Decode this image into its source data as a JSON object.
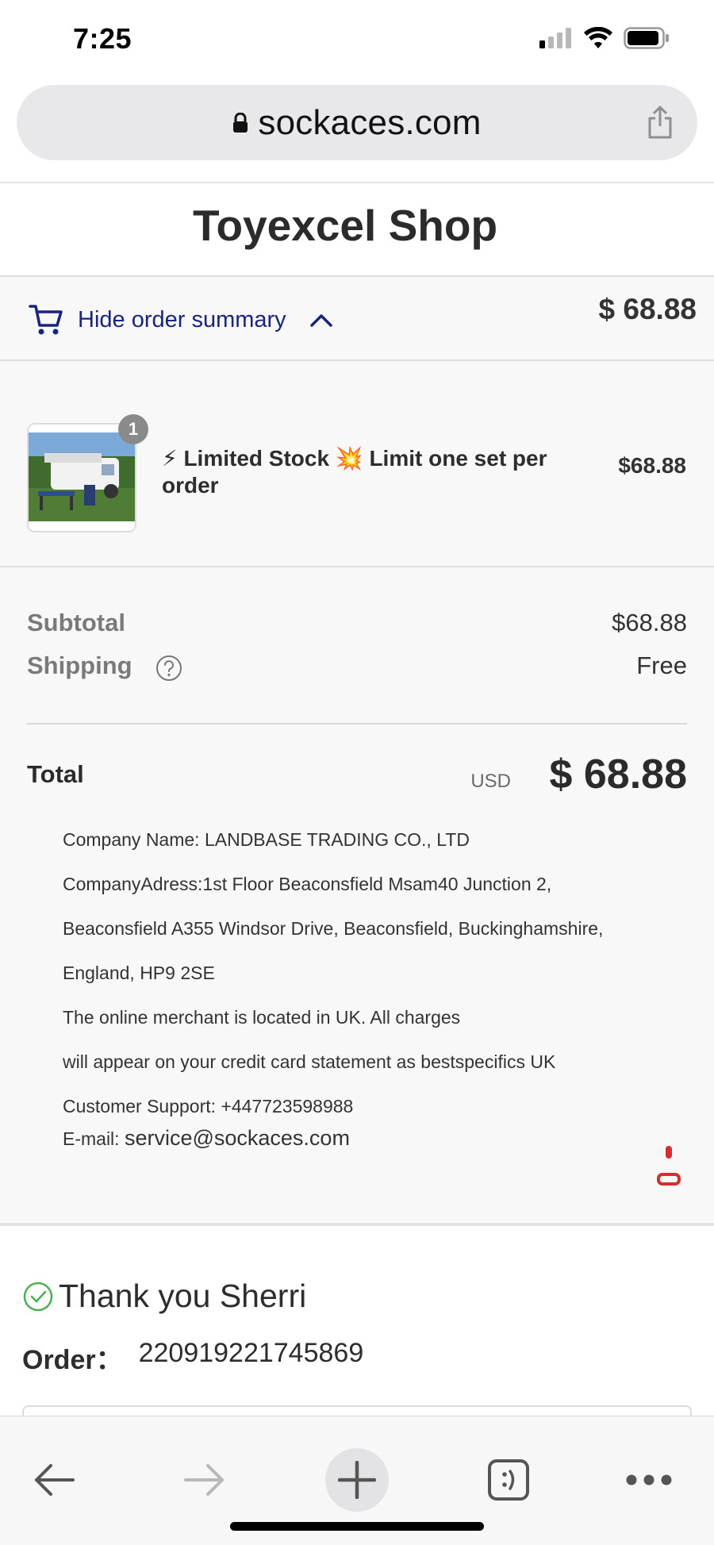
{
  "status_bar": {
    "time": "7:25",
    "icons": [
      "signal-icon",
      "wifi-icon",
      "battery-icon"
    ]
  },
  "browser": {
    "url": "sockaces.com",
    "icons": [
      "lock-icon",
      "share-icon"
    ]
  },
  "shop": {
    "title": "Toyexcel Shop"
  },
  "order_summary_toggle": {
    "label": "Hide order summary",
    "price": "$ 68.88",
    "accent_color": "#1a237e",
    "icons": [
      "cart-icon",
      "chevron-up-icon"
    ]
  },
  "product": {
    "quantity": "1",
    "title": "⚡ Limited Stock 💥 Limit one set per order",
    "price": "$68.88"
  },
  "totals": {
    "subtotal_label": "Subtotal",
    "subtotal_value": "$68.88",
    "shipping_label": "Shipping",
    "shipping_value": "Free",
    "total_label": "Total",
    "currency": "USD",
    "total_value": "$ 68.88"
  },
  "company": {
    "name_line": "Company Name: LANDBASE TRADING CO., LTD",
    "address_line1": "CompanyAdress:1st Floor Beaconsfield Msam40 Junction 2,",
    "address_line2": "Beaconsfield A355 Windsor Drive, Beaconsfield, Buckinghamshire,",
    "address_line3": "England, HP9 2SE",
    "merchant_line1": "The online merchant is located in UK. All charges",
    "merchant_line2": "will appear on your credit card statement as bestspecifics UK",
    "support_line": "Customer Support: +447723598988",
    "email_label": "E-mail:",
    "email_value": "service@sockaces.com"
  },
  "confirmation": {
    "thanks": "Thank you Sherri",
    "order_label": "Order：",
    "order_number": "220919221745869",
    "check_color": "#4caf50"
  },
  "toolbar": {
    "icons": [
      "back-arrow-icon",
      "forward-arrow-icon",
      "new-tab-plus-icon",
      "tabs-icon",
      "more-icon"
    ]
  }
}
